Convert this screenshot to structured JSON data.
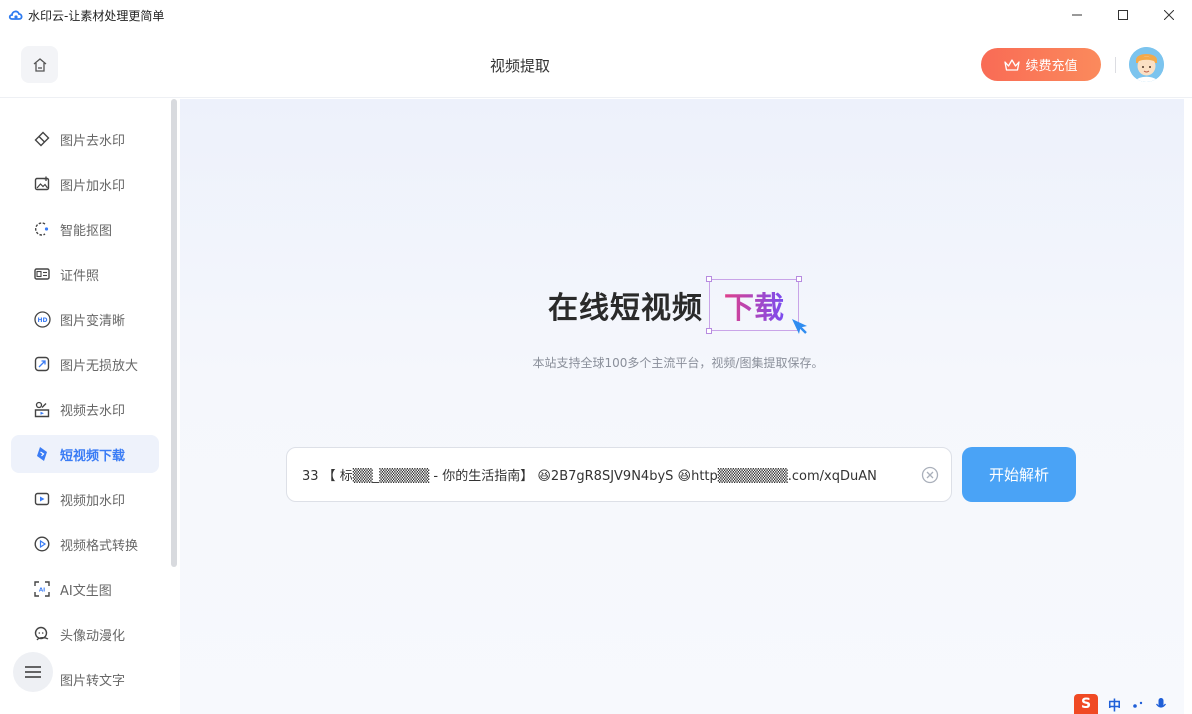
{
  "window": {
    "title": "水印云-让素材处理更简单"
  },
  "header": {
    "title": "视频提取",
    "vip_label": "续费充值"
  },
  "sidebar": {
    "items": [
      {
        "label": "图片去水印",
        "icon": "eraser-icon"
      },
      {
        "label": "图片加水印",
        "icon": "image-add-icon"
      },
      {
        "label": "智能抠图",
        "icon": "cutout-icon"
      },
      {
        "label": "证件照",
        "icon": "id-card-icon"
      },
      {
        "label": "图片变清晰",
        "icon": "hd-icon"
      },
      {
        "label": "图片无损放大",
        "icon": "enlarge-icon"
      },
      {
        "label": "视频去水印",
        "icon": "video-eraser-icon"
      },
      {
        "label": "短视频下载",
        "icon": "download-icon",
        "active": true
      },
      {
        "label": "视频加水印",
        "icon": "video-add-icon"
      },
      {
        "label": "视频格式转换",
        "icon": "format-convert-icon"
      },
      {
        "label": "AI文生图",
        "icon": "ai-image-icon"
      },
      {
        "label": "头像动漫化",
        "icon": "avatar-anime-icon"
      },
      {
        "label": "图片转文字",
        "icon": "ocr-icon"
      }
    ]
  },
  "main": {
    "hero_title": "在线短视频",
    "hero_highlight": "下载",
    "subtitle": "本站支持全球100多个主流平台，视频/图集提取保存。",
    "url_input": {
      "value": "33 【 标▒▒_▒▒▒▒▒ - 你的生活指南】 😆2B7gR8SJV9N4byS 😆http▒▒▒▒▒▒▒.com/xqDuAN"
    },
    "parse_button": "开始解析"
  },
  "tray": {
    "ime_s": "S",
    "ime_lang": "中"
  },
  "colors": {
    "accent": "#4aa3f6",
    "active_nav": "#3a7cf5",
    "vip_start": "#f96b55",
    "vip_end": "#fb8a5c"
  }
}
